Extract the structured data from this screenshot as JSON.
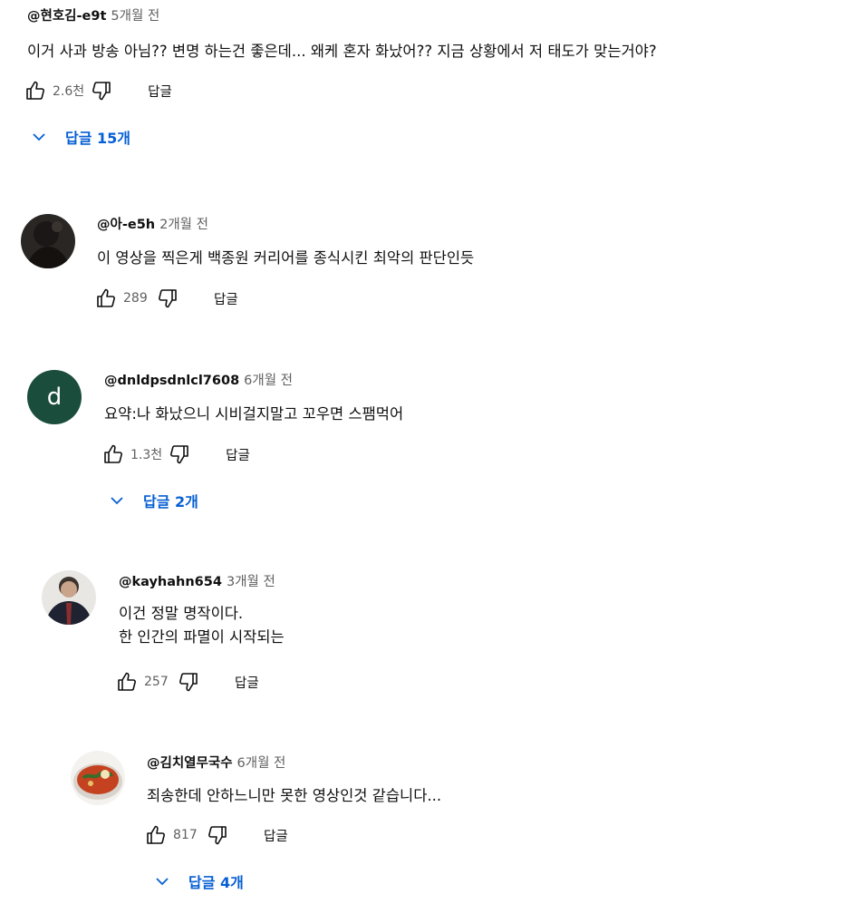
{
  "accent_color": "#065fd4",
  "comments": [
    {
      "author": "@현호김-e9t",
      "time": "5개월 전",
      "text_lines": [
        "이거 사과 방송 아님?? 변명 하는건 좋은데... 왜케 혼자 화났어?? 지금 상황에서 저 태도가 맞는거야?"
      ],
      "likes": "2.6천",
      "reply_label": "답글",
      "replies_toggle": "답글 15개"
    },
    {
      "author": "@아-e5h",
      "time": "2개월 전",
      "text_lines": [
        "이 영상을 찍은게 백종원 커리어를 종식시킨 최악의 판단인듯"
      ],
      "likes": "289",
      "reply_label": "답글"
    },
    {
      "author": "@dnldpsdnlcl7608",
      "time": "6개월 전",
      "avatar_letter": "d",
      "text_lines": [
        "요약:나 화났으니 시비걸지말고 꼬우면 스팸먹어"
      ],
      "likes": "1.3천",
      "reply_label": "답글",
      "replies_toggle": "답글 2개"
    },
    {
      "author": "@kayhahn654",
      "time": "3개월 전",
      "text_lines": [
        "이건 정말 명작이다.",
        "한 인간의 파멸이 시작되는"
      ],
      "likes": "257",
      "reply_label": "답글"
    },
    {
      "author": "@김치열무국수",
      "time": "6개월 전",
      "text_lines": [
        "죄송한데 안하느니만 못한 영상인것 같습니다..."
      ],
      "likes": "817",
      "reply_label": "답글",
      "replies_toggle": "답글 4개"
    }
  ]
}
